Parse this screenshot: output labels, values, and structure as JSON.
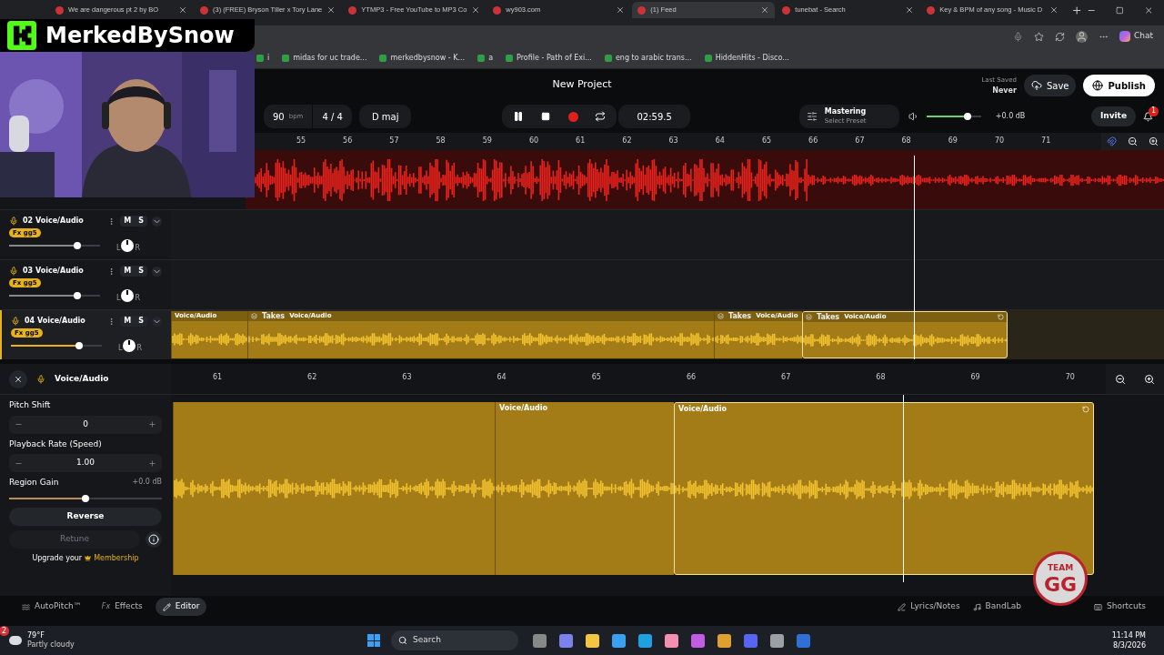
{
  "browser": {
    "tabs": [
      {
        "title": "We are dangerous pt 2 by BO",
        "selected": false
      },
      {
        "title": "(3) (FREE) Bryson Tiller x Tory Lane",
        "selected": false
      },
      {
        "title": "YTMP3 - Free YouTube to MP3 Co",
        "selected": false
      },
      {
        "title": "wy903.com",
        "selected": false
      },
      {
        "title": "(1) Feed",
        "selected": true
      },
      {
        "title": "tunebat - Search",
        "selected": false
      },
      {
        "title": "Key & BPM of any song - Music D",
        "selected": false
      }
    ],
    "bookmarks": [
      "i",
      "midas for uc trade...",
      "merkedbysnow - K...",
      "a",
      "Profile - Path of Exi...",
      "eng to arabic trans...",
      "HiddenHits - Disco..."
    ],
    "chat_button": "Chat"
  },
  "overlay": {
    "channel_name": "MerkedBySnow",
    "sticker_top": "TEAM",
    "sticker_main": "GG"
  },
  "project": {
    "title": "New Project",
    "last_saved_label": "Last Saved",
    "last_saved": "Never",
    "save": "Save",
    "publish": "Publish",
    "invite": "Invite",
    "notifications": "1"
  },
  "transport": {
    "bpm": "90",
    "bpm_unit": "bpm",
    "time_signature": "4 / 4",
    "key": "D maj",
    "time": "02:59.5",
    "playing": true
  },
  "mastering": {
    "label": "Mastering",
    "preset": "Select Preset"
  },
  "master_volume": {
    "level": 0.75,
    "reading": "+0.0 dB"
  },
  "ruler": [
    "55",
    "56",
    "57",
    "58",
    "59",
    "60",
    "61",
    "62",
    "63",
    "64",
    "65",
    "66",
    "67",
    "68",
    "69",
    "70",
    "71"
  ],
  "tracks": [
    {
      "number": "02",
      "name": "Voice/Audio",
      "fx": "Fx gg5",
      "mute": "M",
      "solo": "S",
      "level": 0.75,
      "pan_left": "L",
      "pan_right": "R",
      "selected": false
    },
    {
      "number": "03",
      "name": "Voice/Audio",
      "fx": "Fx gg5",
      "mute": "M",
      "solo": "S",
      "level": 0.75,
      "pan_left": "L",
      "pan_right": "R",
      "selected": false
    },
    {
      "number": "04",
      "name": "Voice/Audio",
      "fx": "Fx gg5",
      "mute": "M",
      "solo": "S",
      "level": 0.75,
      "pan_left": "L",
      "pan_right": "R",
      "selected": true,
      "regions": [
        {
          "name": "Voice/Audio",
          "selected": false
        },
        {
          "takes": "Takes",
          "name": "Voice/Audio",
          "selected": false
        },
        {
          "takes": "Takes",
          "name": "Voice/Audio",
          "selected": false
        },
        {
          "takes": "Takes",
          "name": "Voice/Audio",
          "selected": true
        }
      ]
    }
  ],
  "editor": {
    "title": "Voice/Audio",
    "pitch_shift": {
      "label": "Pitch Shift",
      "value": "0"
    },
    "playback_rate": {
      "label": "Playback Rate (Speed)",
      "value": "1.00"
    },
    "region_gain": {
      "label": "Region Gain",
      "reading": "+0.0 dB",
      "level": 0.5
    },
    "reverse": "Reverse",
    "retune": {
      "label": "Retune",
      "disabled": true
    },
    "upgrade_text": "Upgrade your",
    "upgrade_link": "Membership",
    "ruler": [
      "61",
      "62",
      "63",
      "64",
      "65",
      "66",
      "67",
      "68",
      "69",
      "70"
    ],
    "regions": [
      {
        "selected": false
      },
      {
        "name": "Voice/Audio",
        "selected": false
      },
      {
        "name": "Voice/Audio",
        "selected": true
      }
    ]
  },
  "bottom_tabs": [
    {
      "label": "AutoPitch™",
      "selected": false
    },
    {
      "prefix": "Fx",
      "label": "Effects",
      "selected": false
    },
    {
      "label": "Editor",
      "selected": true
    }
  ],
  "bottom_right": [
    "Lyrics/Notes",
    "BandLab",
    "Shortcuts"
  ],
  "taskbar": {
    "temperature": "79°F",
    "weather": "Partly cloudy",
    "weather_badge": "2",
    "search": "Search",
    "time": "11:14 PM",
    "date": "8/3/2026"
  }
}
